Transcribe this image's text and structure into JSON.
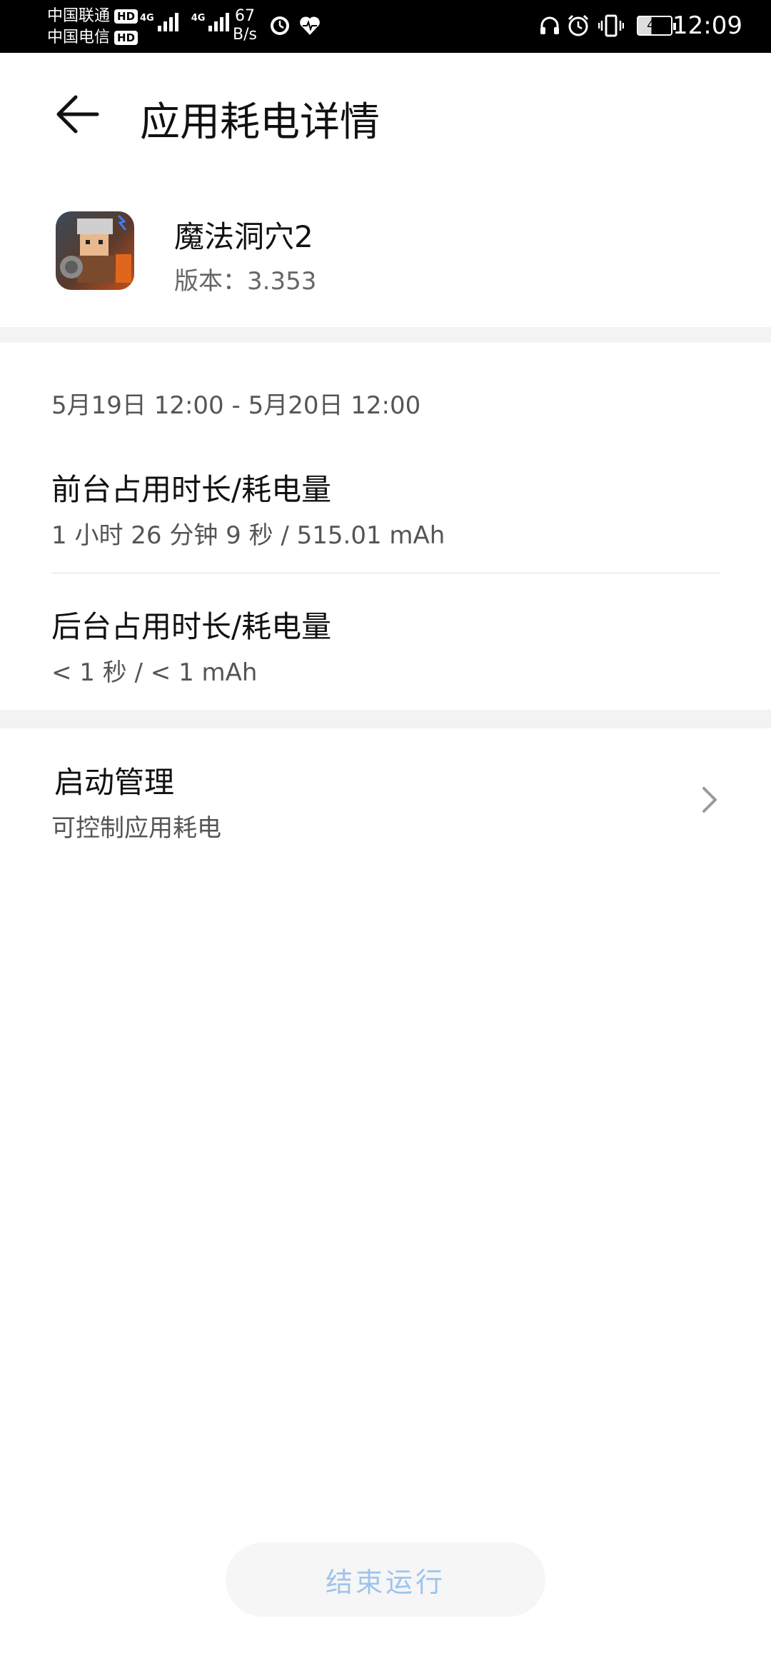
{
  "status_bar": {
    "carrier_1": "中国联通",
    "carrier_2": "中国电信",
    "hd_badge": "HD",
    "network_1": "4G",
    "network_2": "4G",
    "speed_value": "67",
    "speed_unit": "B/s",
    "battery_level": "40",
    "time": "12:09",
    "icons": [
      "clock-face-icon",
      "health-heart-icon",
      "headphones-icon",
      "alarm-icon",
      "vibrate-icon"
    ]
  },
  "header": {
    "title": "应用耗电详情",
    "back_icon": "back-arrow-icon"
  },
  "app": {
    "name": "魔法洞穴2",
    "version": "版本：3.353"
  },
  "usage": {
    "date_range": "5月19日 12:00 - 5月20日 12:00",
    "foreground": {
      "title": "前台占用时长/耗电量",
      "value": "1 小时 26 分钟 9 秒 / 515.01 mAh"
    },
    "background": {
      "title": "后台占用时长/耗电量",
      "value": "< 1 秒 / < 1 mAh"
    }
  },
  "startup": {
    "title": "启动管理",
    "subtitle": "可控制应用耗电",
    "chevron_icon": "chevron-right-icon"
  },
  "actions": {
    "end_button_label": "结束运行"
  },
  "colors": {
    "status_bar_bg": "#000000",
    "section_divider": "#f3f3f3",
    "end_button_text": "#9ec4ec"
  }
}
